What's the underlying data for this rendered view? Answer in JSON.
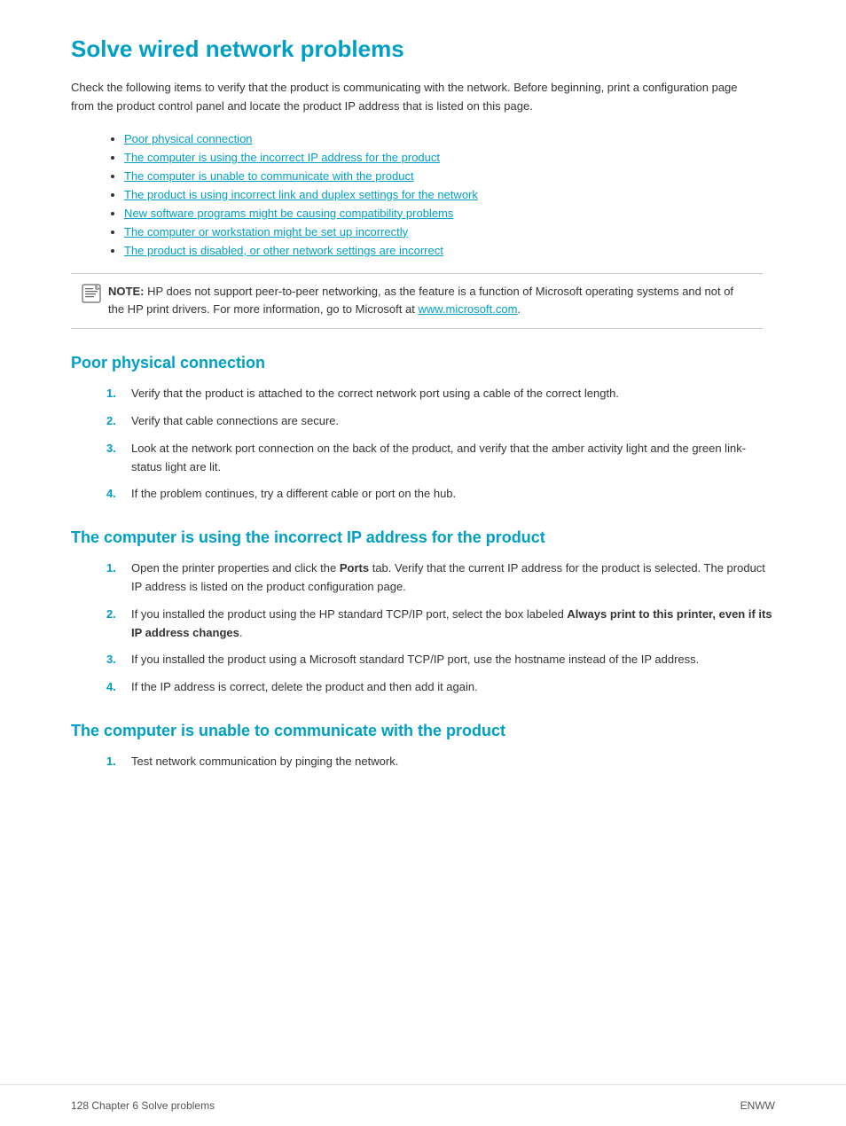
{
  "page": {
    "title": "Solve wired network problems",
    "intro": "Check the following items to verify that the product is communicating with the network. Before beginning, print a configuration page from the product control panel and locate the product IP address that is listed on this page.",
    "toc_items": [
      {
        "label": "Poor physical connection",
        "anchor": "#poor-physical"
      },
      {
        "label": "The computer is using the incorrect IP address for the product",
        "anchor": "#incorrect-ip"
      },
      {
        "label": "The computer is unable to communicate with the product",
        "anchor": "#unable-communicate"
      },
      {
        "label": "The product is using incorrect link and duplex settings for the network",
        "anchor": "#link-duplex"
      },
      {
        "label": "New software programs might be causing compatibility problems",
        "anchor": "#new-software"
      },
      {
        "label": "The computer or workstation might be set up incorrectly",
        "anchor": "#workstation-setup"
      },
      {
        "label": "The product is disabled, or other network settings are incorrect",
        "anchor": "#product-disabled"
      }
    ],
    "note": {
      "label": "NOTE:",
      "text": "HP does not support peer-to-peer networking, as the feature is a function of Microsoft operating systems and not of the HP print drivers. For more information, go to Microsoft at ",
      "link_text": "www.microsoft.com",
      "link_url": "http://www.microsoft.com",
      "text_after": "."
    },
    "sections": [
      {
        "id": "poor-physical",
        "title": "Poor physical connection",
        "steps": [
          {
            "num": "1.",
            "text": "Verify that the product is attached to the correct network port using a cable of the correct length."
          },
          {
            "num": "2.",
            "text": "Verify that cable connections are secure."
          },
          {
            "num": "3.",
            "text": "Look at the network port connection on the back of the product, and verify that the amber activity light and the green link-status light are lit."
          },
          {
            "num": "4.",
            "text": "If the problem continues, try a different cable or port on the hub."
          }
        ]
      },
      {
        "id": "incorrect-ip",
        "title": "The computer is using the incorrect IP address for the product",
        "steps": [
          {
            "num": "1.",
            "text": "Open the printer properties and click the <strong>Ports</strong> tab. Verify that the current IP address for the product is selected. The product IP address is listed on the product configuration page."
          },
          {
            "num": "2.",
            "text": "If you installed the product using the HP standard TCP/IP port, select the box labeled <strong>Always print to this printer, even if its IP address changes</strong>."
          },
          {
            "num": "3.",
            "text": "If you installed the product using a Microsoft standard TCP/IP port, use the hostname instead of the IP address."
          },
          {
            "num": "4.",
            "text": "If the IP address is correct, delete the product and then add it again."
          }
        ]
      },
      {
        "id": "unable-communicate",
        "title": "The computer is unable to communicate with the product",
        "steps": [
          {
            "num": "1.",
            "text": "Test network communication by pinging the network."
          }
        ]
      }
    ],
    "footer": {
      "left": "128  Chapter 6  Solve problems",
      "right": "ENWW"
    }
  }
}
